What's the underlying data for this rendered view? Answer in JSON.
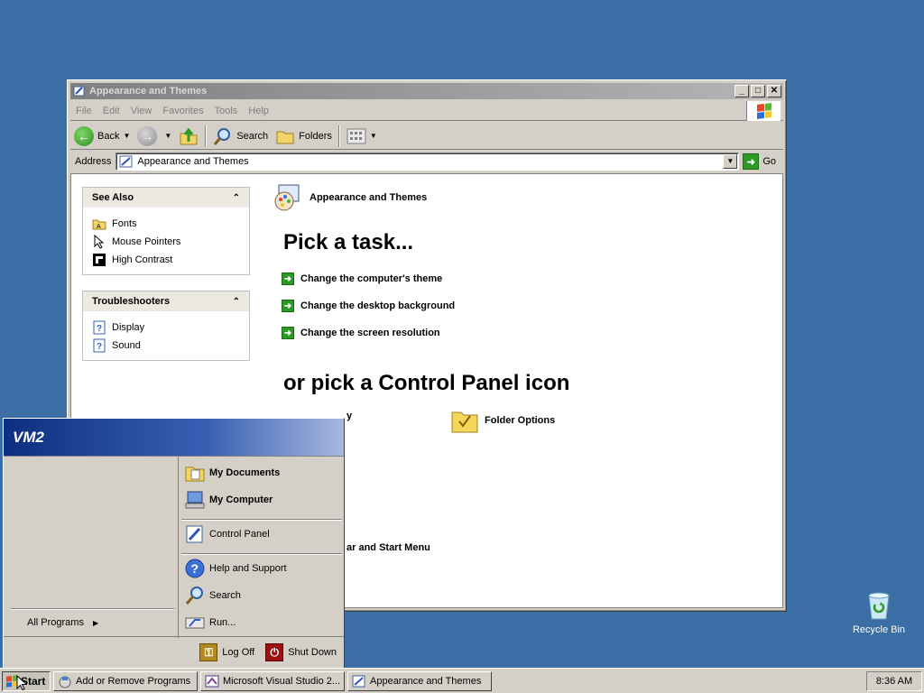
{
  "window": {
    "title": "Appearance and Themes",
    "controls": {
      "minimize": "_",
      "maximize": "□",
      "close": "✕"
    }
  },
  "menu": [
    "File",
    "Edit",
    "View",
    "Favorites",
    "Tools",
    "Help"
  ],
  "toolbar": {
    "back_label": "Back",
    "search_label": "Search",
    "folders_label": "Folders"
  },
  "address": {
    "label": "Address",
    "value": "Appearance and Themes",
    "go_label": "Go"
  },
  "see_also": {
    "title": "See Also",
    "items": [
      {
        "label": "Fonts",
        "icon": "fonts-folder-icon"
      },
      {
        "label": "Mouse Pointers",
        "icon": "mouse-pointer-icon"
      },
      {
        "label": "High Contrast",
        "icon": "high-contrast-icon"
      }
    ]
  },
  "troubleshooters": {
    "title": "Troubleshooters",
    "items": [
      {
        "label": "Display",
        "icon": "help-icon"
      },
      {
        "label": "Sound",
        "icon": "help-icon"
      }
    ]
  },
  "main": {
    "category_title": "Appearance and Themes",
    "pick_task": "Pick a task...",
    "tasks": [
      "Change the computer's theme",
      "Change the desktop background",
      "Change the screen resolution"
    ],
    "pick_icon": "or pick a Control Panel icon",
    "icons": [
      {
        "label": "y",
        "icon": "display-icon"
      },
      {
        "label": "Folder Options",
        "icon": "folder-options-icon"
      },
      {
        "label": "ar and Start Menu",
        "icon": "taskbar-icon"
      }
    ]
  },
  "start_menu": {
    "user": "VM2",
    "all_programs": "All Programs",
    "items": [
      {
        "label": "My Documents",
        "icon": "my-documents-icon",
        "bold": true
      },
      {
        "label": "My Computer",
        "icon": "my-computer-icon",
        "bold": true
      },
      {
        "label": "Control Panel",
        "icon": "control-panel-icon",
        "bold": false
      },
      {
        "label": "Help and Support",
        "icon": "help-support-icon",
        "bold": false
      },
      {
        "label": "Search",
        "icon": "search-icon",
        "bold": false
      },
      {
        "label": "Run...",
        "icon": "run-icon",
        "bold": false
      }
    ],
    "log_off": "Log Off",
    "shut_down": "Shut Down"
  },
  "taskbar": {
    "start_label": "Start",
    "tasks": [
      "Add or Remove Programs",
      "Microsoft Visual Studio 2...",
      "Appearance and Themes"
    ],
    "clock": "8:36 AM"
  },
  "desktop": {
    "recycle_bin": "Recycle Bin"
  },
  "colors": {
    "desktop": "#3a6ea5",
    "start_header": "#0c2f80",
    "go_green": "#2e9a26"
  }
}
